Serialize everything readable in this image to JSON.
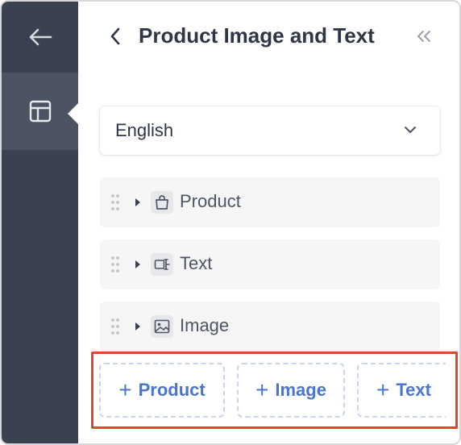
{
  "rail": {
    "back_icon": "arrow-left-icon",
    "layout_icon": "layout-icon"
  },
  "header": {
    "title": "Product Image and Text",
    "back_icon": "chevron-left-icon",
    "collapse_icon": "double-chevron-left-icon"
  },
  "language": {
    "value": "English",
    "icon": "chevron-down-icon"
  },
  "blocks": [
    {
      "label": "Product",
      "icon": "shopping-bag-icon"
    },
    {
      "label": "Text",
      "icon": "text-field-icon"
    },
    {
      "label": "Image",
      "icon": "image-icon"
    }
  ],
  "add_buttons": [
    {
      "label": "Product",
      "prefix": "+"
    },
    {
      "label": "Image",
      "prefix": "+"
    },
    {
      "label": "Text",
      "prefix": "+"
    }
  ],
  "colors": {
    "rail_bg": "#3a4150",
    "rail_active": "#4c5363",
    "accent": "#4a76cf",
    "highlight": "#e2452e"
  }
}
